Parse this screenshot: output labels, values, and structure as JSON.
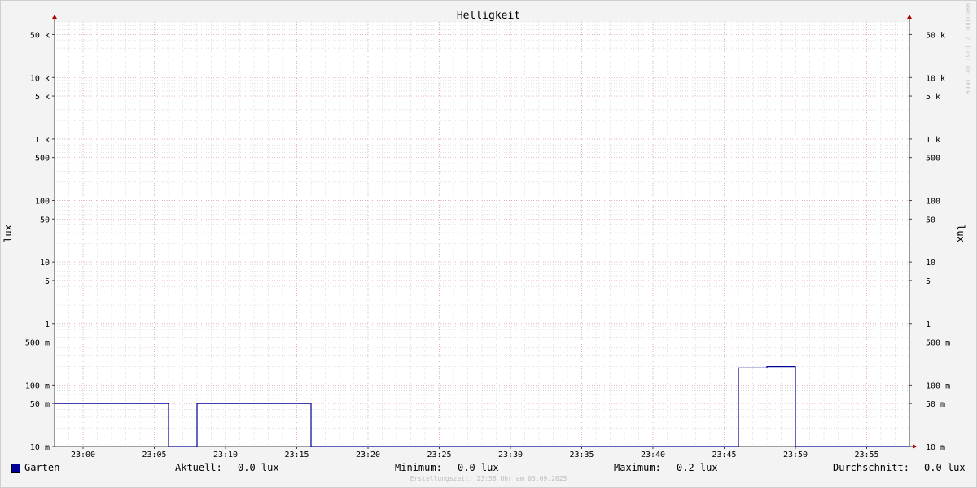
{
  "chart_data": {
    "type": "line",
    "title": "Helligkeit",
    "ylabel": "lux",
    "ylabel_right": "lux",
    "y_scale": "log",
    "ylim": [
      0.01,
      80000
    ],
    "xlim": [
      "22:58",
      "23:58"
    ],
    "x_ticks": [
      "23:00",
      "23:05",
      "23:10",
      "23:15",
      "23:20",
      "23:25",
      "23:30",
      "23:35",
      "23:40",
      "23:45",
      "23:50",
      "23:55"
    ],
    "y_ticks": [
      {
        "value": 50000,
        "label": "50 k"
      },
      {
        "value": 10000,
        "label": "10 k"
      },
      {
        "value": 5000,
        "label": "5 k"
      },
      {
        "value": 1000,
        "label": "1 k"
      },
      {
        "value": 500,
        "label": "500"
      },
      {
        "value": 100,
        "label": "100"
      },
      {
        "value": 50,
        "label": "50"
      },
      {
        "value": 10,
        "label": "10"
      },
      {
        "value": 5,
        "label": "5"
      },
      {
        "value": 1,
        "label": "1"
      },
      {
        "value": 0.5,
        "label": "500 m"
      },
      {
        "value": 0.1,
        "label": "100 m"
      },
      {
        "value": 0.05,
        "label": "50 m"
      },
      {
        "value": 0.01,
        "label": "10 m"
      }
    ],
    "series": [
      {
        "name": "Garten",
        "color": "#000099",
        "points": [
          [
            "22:58",
            0.05
          ],
          [
            "23:06",
            0.05
          ],
          [
            "23:06",
            0.01
          ],
          [
            "23:08",
            0.01
          ],
          [
            "23:08",
            0.05
          ],
          [
            "23:16",
            0.05
          ],
          [
            "23:16",
            0.01
          ],
          [
            "23:46",
            0.01
          ],
          [
            "23:46",
            0.19
          ],
          [
            "23:48",
            0.19
          ],
          [
            "23:48",
            0.2
          ],
          [
            "23:50",
            0.2
          ],
          [
            "23:50",
            0.01
          ],
          [
            "23:58",
            0.01
          ]
        ]
      }
    ],
    "grid": true
  },
  "legend": {
    "series_name": "Garten",
    "current_label": "Aktuell:",
    "current_value": "0.0 lux",
    "min_label": "Minimum:",
    "min_value": "0.0 lux",
    "max_label": "Maximum:",
    "max_value": "0.2 lux",
    "avg_label": "Durchschnitt:",
    "avg_value": "0.0 lux"
  },
  "footer": "Erstellungszeit: 23:58 Uhr am 03.09.2025",
  "watermark": "RRDTOOL / TOBI OETIKER",
  "colors": {
    "series": "#000099",
    "major_grid": "#e8a0a0",
    "minor_grid": "#cccccc",
    "axis": "#404040",
    "arrow": "#aa0000"
  }
}
